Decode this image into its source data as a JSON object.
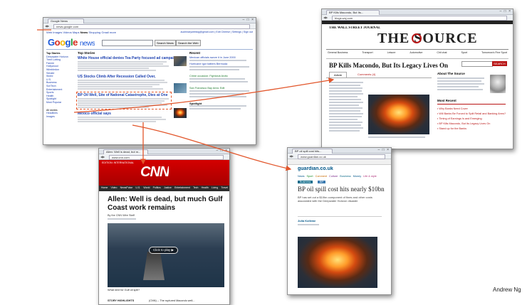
{
  "author_credit": "Andrew Ng",
  "google_news": {
    "tab_label": "Google News",
    "url": "news.google.com",
    "top_links": [
      "Web",
      "Images",
      "Videos",
      "Maps",
      "News",
      "Shopping",
      "Gmail",
      "more"
    ],
    "account": "auchinaryweblog@gmail.com | Edit Cheese | Settings | Sign out",
    "logo_google": "Google",
    "logo_news": "news",
    "search_news_btn": "Search News",
    "search_web_btn": "Search the Web",
    "top_stories_label": "Top Stories",
    "recent_label": "Recent",
    "sidebar": [
      "Top Stories",
      "Deepwater Horizon",
      "Trent Lotting",
      "Fannie",
      "Hollywood",
      "Wimbledon",
      "Senate",
      "World",
      "U.S.",
      "Business",
      "Sci/Tech",
      "Entertainment",
      "Sports",
      "Health",
      "Spotlight",
      "Most Popular"
    ],
    "stories": [
      "White House official denies Tea Party focused ad campaign",
      "US Stocks Climb After Recession Called Over,",
      "BP Oil Well, Site of National Catastrophe, Dies at One",
      "Mexico official says",
      "Mexico Storm"
    ],
    "recent_items": [
      "Mexican officials swore it in June 2000",
      "Hurricane Igor batters Bermuda",
      "Crime occasion: Fightclub Arctic",
      "San Francisco Bay Area: Edit",
      "Spotlight"
    ],
    "footer_labels": [
      "All stories",
      "Headlines",
      "Images"
    ]
  },
  "wsj": {
    "tab_label": "BP Kills Macondo, But Its...",
    "url": "blogs.wsj.com",
    "masthead": "THE WALL STREET JOURNAL",
    "brand": "THE SOURCE",
    "section_links": [
      "General Business",
      "Transport",
      "Leisure",
      "Automotive",
      "Chit chat",
      "Sport",
      "Tomorrow's Fine Sport"
    ],
    "headline": "BP Kills Macondo, But Its Legacy Lives On",
    "article_tab": "Article",
    "comments_tab": "Comments (4)",
    "search_label": "SEARCH",
    "about_title": "About The Source",
    "most_recent": "Most Recent",
    "recent_items": [
      "Why Banks Need Cover",
      "Will Banks Be Forced to Split Retail and Banking Arms?",
      "Timing of Earnings Is and Emerging",
      "BP Kills Macondo, But Its Legacy Lives On",
      "Stand up for the Banks"
    ]
  },
  "cnn": {
    "tab_label": "Allen: Well is dead, but m...",
    "url": "www.cnn.com",
    "edition": "EDITION: INTERNATIONAL",
    "logo": "CNN",
    "nav": [
      "Home",
      "Video",
      "NewsPulse",
      "U.S.",
      "World",
      "Politics",
      "Justice",
      "Entertainment",
      "Tech",
      "Health",
      "Living",
      "Travel"
    ],
    "headline": "Allen: Well is dead, but much Gulf Coast work remains",
    "byline": "By the CNN Wire Staff",
    "video_label": "Click to play",
    "caption": "What next for Gulf oil spill?",
    "footer_left": "STORY HIGHLIGHTS",
    "footer_right": "(CNN) -- The ruptured Macondo well..."
  },
  "guardian": {
    "tab_label": "BP oil spill cost hits...",
    "url": "www.guardian.co.uk",
    "logo": "guardian.co.uk",
    "sections": [
      "News",
      "Sport",
      "Comment",
      "Culture",
      "Business",
      "Money",
      "Life & style"
    ],
    "section_tag": "Business",
    "subtag": "BP",
    "headline": "BP oil spill cost hits nearly $10bn",
    "standfirst": "BP has set out a $10bn component of fines and other costs associated with the Deepwater Horizon disaster",
    "byline": "Julia Kollewe"
  },
  "colors": {
    "arrow": "#e2562b",
    "wsj_red": "#b81414",
    "cnn_red": "#cc0000",
    "google_blue": "#1a3fb0",
    "guardian_blue": "#005689"
  }
}
